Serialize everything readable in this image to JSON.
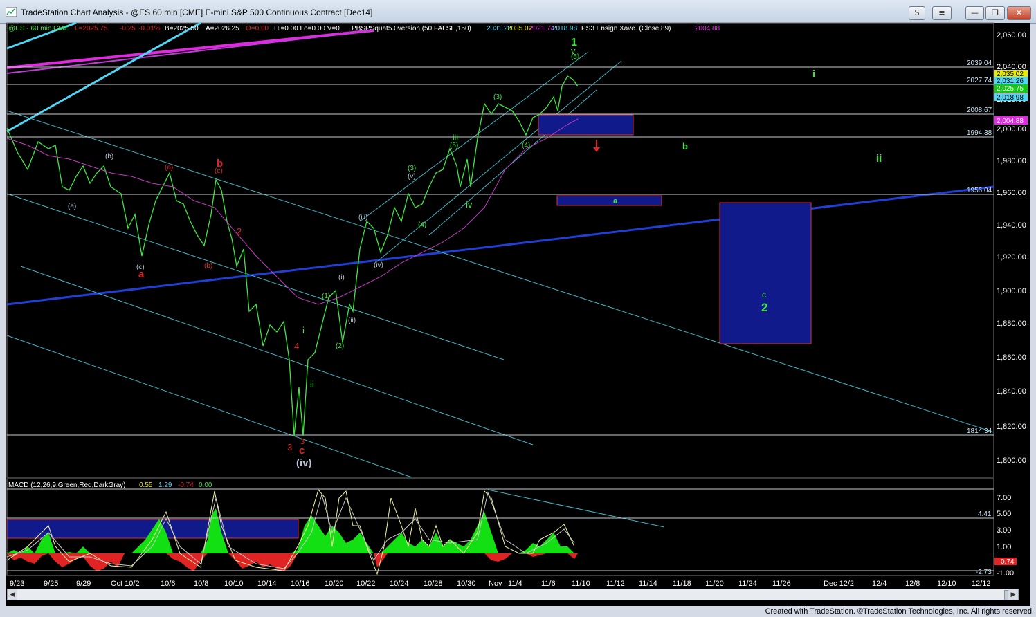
{
  "window": {
    "title": "TradeStation Chart Analysis - @ES 60 min [CME] E-mini S&P 500 Continuous Contract [Dec14]",
    "btn_s": "S",
    "btn_menu": "≡",
    "btn_min": "—",
    "btn_restore": "❐",
    "btn_close": "✕"
  },
  "legend": {
    "symbol": "@ES - 60 min CME",
    "last": "L=2025.75",
    "change": "-0.25",
    "pct": "-0.01%",
    "bid": "B=2025.50",
    "ask": "A=2026.25",
    "open": "O=0.00",
    "hilo": "Hi=0.00 Lo=0.00 V=0",
    "study": "PBSPSquat5.0version (50,FALSE,150)",
    "study_v1": "2031.26",
    "study_v2": "2035.02",
    "study_v3": "2021.74",
    "study_v4": "2018.98",
    "ma": "PS3 Ensign Xave. (Close,89)",
    "ma_val": "2004.88"
  },
  "macd_legend": {
    "name": "MACD (12,26,9,Green,Red,DarkGray)",
    "v1": "0.55",
    "v2": "1.29",
    "v3": "-0.74",
    "v4": "0.00"
  },
  "price_axis": [
    "2,060.00",
    "2,040.00",
    "2,020.00",
    "2,000.00",
    "1,980.00",
    "1,960.00",
    "1,940.00",
    "1,920.00",
    "1,900.00",
    "1,880.00",
    "1,860.00",
    "1,840.00",
    "1,820.00",
    "1,800.00"
  ],
  "hlines": [
    "2039.04",
    "2027.74",
    "2008.67",
    "1994.38",
    "1956.04",
    "1814.34"
  ],
  "axis_tags": [
    "2,035.02",
    "2,031.26",
    "2,025.75",
    "2,018.98",
    "2,004.88"
  ],
  "macd_axis": [
    "7.00",
    "5.00",
    "3.00",
    "1.00",
    "-1.00"
  ],
  "macd_tags": [
    "4.41",
    "0.74",
    "-2.73"
  ],
  "date_axis": [
    "9/23",
    "9/25",
    "9/29",
    "Oct 10/2",
    "10/6",
    "10/8",
    "10/10",
    "10/14",
    "10/16",
    "10/20",
    "10/22",
    "10/24",
    "10/28",
    "10/30",
    "Nov",
    "11/4",
    "11/6",
    "11/10",
    "11/12",
    "11/14",
    "11/18",
    "11/20",
    "11/24",
    "11/26",
    "Dec 12/2",
    "12/4",
    "12/8",
    "12/10",
    "12/12"
  ],
  "labels": {
    "w1": "1",
    "wv": "v",
    "w5p": "(5)",
    "w3p": "(3)",
    "w4p": "(4)",
    "wiii": "iii",
    "w5p2": "(5)",
    "wiv": "iv",
    "w3p2": "(3)",
    "wv2": "(v)",
    "w4p2": "(4)",
    "wiiip": "(iii)",
    "wivp": "(iv)",
    "wip": "(i)",
    "wiip": "(ii)",
    "w1p": "(1)",
    "w2p": "(2)",
    "ci": "i",
    "cii": "ii",
    "c3a": "3",
    "c3b": "3",
    "cc": "c",
    "civ": "(iv)",
    "c4": "4",
    "c2": "2",
    "cb": "b",
    "cbp": "(c)",
    "cbb": "(b)",
    "ca": "(a)",
    "caa": "a",
    "cc1": "(c)",
    "cb1": "(b)",
    "ca1": "(a)",
    "cc2": "(c)",
    "ca2": "a",
    "fi": "i",
    "fb": "b",
    "fii": "ii",
    "fa": "a",
    "fc": "c",
    "f2": "2"
  },
  "footer": "Created with TradeStation. ©TradeStation Technologies, Inc. All rights reserved."
}
